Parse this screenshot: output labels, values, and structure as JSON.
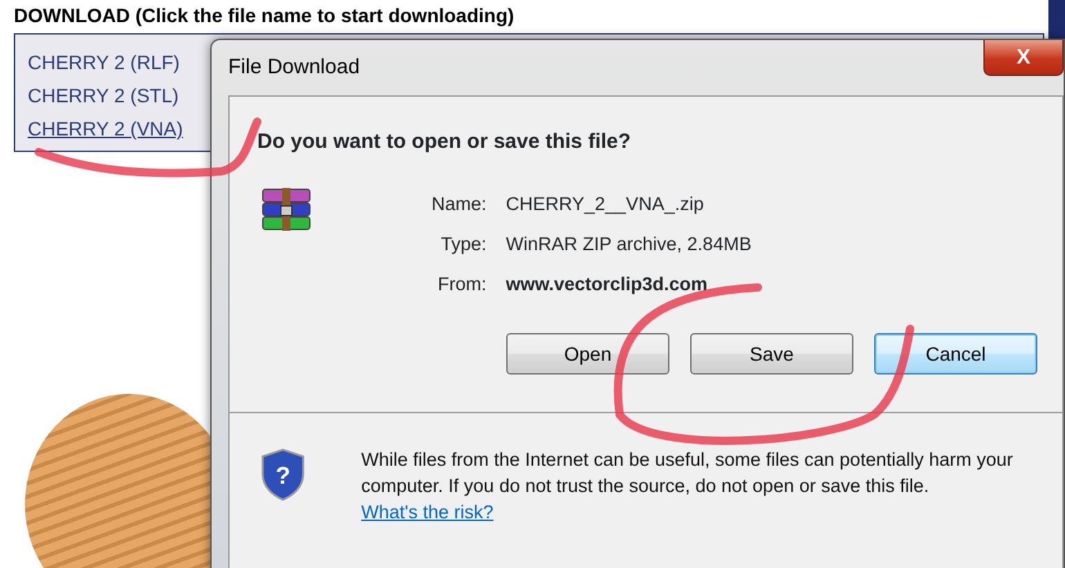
{
  "page": {
    "heading": "DOWNLOAD (Click the file name to start downloading)",
    "links": [
      {
        "label": "CHERRY 2 (RLF)",
        "underlined": false
      },
      {
        "label": "CHERRY 2 (STL)",
        "underlined": false
      },
      {
        "label": "CHERRY 2 (VNA)",
        "underlined": true
      }
    ]
  },
  "dialog": {
    "title": "File Download",
    "close": "X",
    "question": "Do you want to open or save this file?",
    "fields": [
      {
        "label": "Name:",
        "value": "CHERRY_2__VNA_.zip",
        "bold": false
      },
      {
        "label": "Type:",
        "value": "WinRAR ZIP archive, 2.84MB",
        "bold": false
      },
      {
        "label": "From:",
        "value": "www.vectorclip3d.com",
        "bold": true
      }
    ],
    "buttons": [
      {
        "label": "Open",
        "focused": false
      },
      {
        "label": "Save",
        "focused": false
      },
      {
        "label": "Cancel",
        "focused": true
      }
    ],
    "warning": "While files from the Internet can be useful, some files can potentially harm your computer. If you do not trust the source, do not open or save this file.",
    "risk_link": "What's the risk?",
    "shield_symbol": "?"
  }
}
